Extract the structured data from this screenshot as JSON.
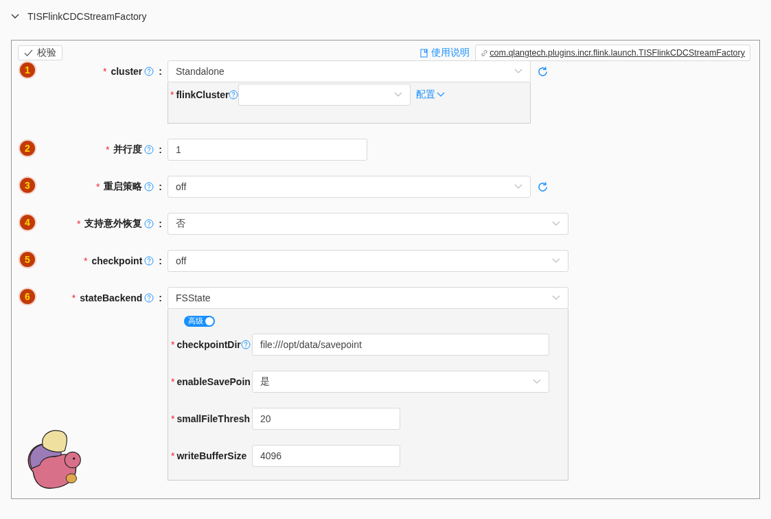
{
  "header": {
    "title": "TISFlinkCDCStreamFactory",
    "expanded": true
  },
  "toolbar": {
    "validate": "校验",
    "doc_link": "使用说明",
    "class_link": "com.qlangtech.plugins.incr.flink.launch.TISFlinkCDCStreamFactory"
  },
  "fields": [
    {
      "index": "1",
      "required": "*",
      "label": "cluster",
      "colon": ":",
      "kind": "select",
      "value": "Standalone",
      "refresh": true,
      "sub": {
        "kind": "inline",
        "fields": [
          {
            "required": "*",
            "label": "flinkCluster",
            "kind": "select",
            "help": true
          }
        ],
        "link": "配置"
      }
    },
    {
      "index": "2",
      "required": "*",
      "label": "并行度",
      "colon": ":",
      "kind": "number",
      "value": "1",
      "refresh": false
    },
    {
      "index": "3",
      "required": "*",
      "label": "重启策略",
      "colon": ":",
      "kind": "select",
      "value": "off",
      "refresh": true
    },
    {
      "index": "4",
      "required": "*",
      "label": "支持意外恢复",
      "colon": ":",
      "kind": "select",
      "value": "否",
      "refresh": false
    },
    {
      "index": "5",
      "required": "*",
      "label": "checkpoint",
      "colon": ":",
      "kind": "select",
      "value": "off",
      "refresh": false
    },
    {
      "index": "6",
      "required": "*",
      "label": "stateBackend",
      "colon": ":",
      "kind": "select",
      "value": "FSState",
      "refresh": false,
      "sub": {
        "kind": "stacked",
        "toggle": {
          "label": "高级",
          "on": true
        },
        "fields": [
          {
            "required": "*",
            "label": "checkpointDir",
            "kind": "text",
            "value": "file:///opt/data/savepoint",
            "help": true
          },
          {
            "required": "*",
            "label": "enableSavePoin",
            "kind": "select",
            "value": "是",
            "help": false
          },
          {
            "required": "*",
            "label": "smallFileThresh",
            "kind": "number",
            "value": "20",
            "help": false
          },
          {
            "required": "*",
            "label": "writeBufferSize",
            "kind": "number",
            "value": "4096",
            "help": false
          }
        ]
      }
    }
  ]
}
